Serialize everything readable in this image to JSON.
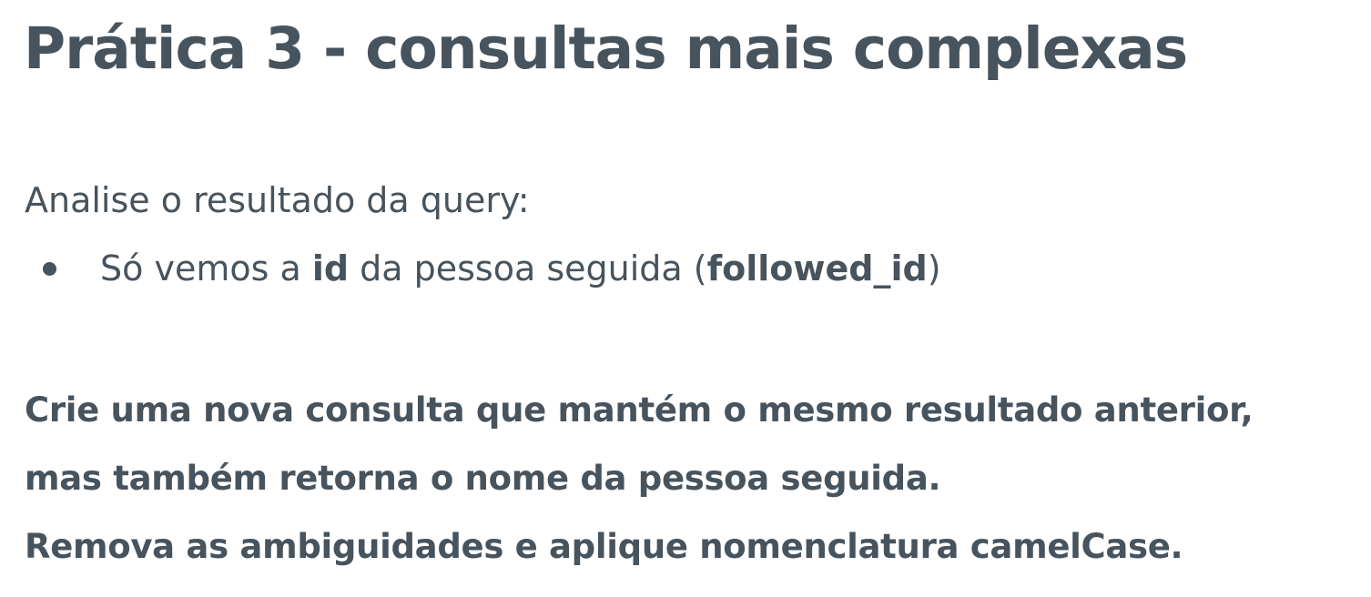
{
  "slide": {
    "title": "Prática 3 - consultas mais complexas",
    "intro": "Analise o resultado da query:",
    "bullet": {
      "text_before": "Só vemos a ",
      "bold_1": "id",
      "text_middle": " da pessoa seguida (",
      "bold_2": "followed_id",
      "text_after": ")"
    },
    "task_lines": [
      "Crie uma nova consulta que mantém o mesmo resultado anterior,",
      "mas também retorna o nome da pessoa seguida.",
      "Remova as ambiguidades e aplique nomenclatura camelCase."
    ]
  }
}
